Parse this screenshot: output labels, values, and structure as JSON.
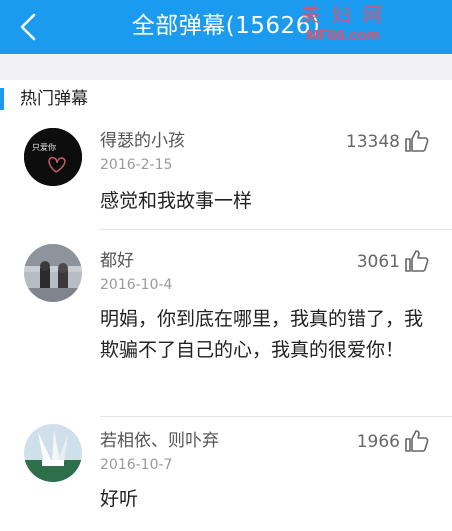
{
  "header": {
    "back_icon": "chevron-left-icon",
    "title": "全部弹幕(15626)",
    "watermark_brand": "美 妇 网",
    "watermark_url": "MF08.com"
  },
  "section": {
    "title": "热门弹幕"
  },
  "comments": [
    {
      "username": "得瑟的小孩",
      "date": "2016-2-15",
      "likes": "13348",
      "text": "感觉和我故事一样",
      "avatar_caption": "只爱你"
    },
    {
      "username": "都好",
      "date": "2016-10-4",
      "likes": "3061",
      "text": "明娟，你到底在哪里，我真的错了，我欺骗不了自己的心，我真的很爱你！"
    },
    {
      "username": "若相依、则卟弃",
      "date": "2016-10-7",
      "likes": "1966",
      "text": "好听"
    }
  ],
  "colors": {
    "accent": "#1a9bf0",
    "watermark": "#e2506a"
  },
  "icons": {
    "like": "thumbs-up-icon"
  }
}
